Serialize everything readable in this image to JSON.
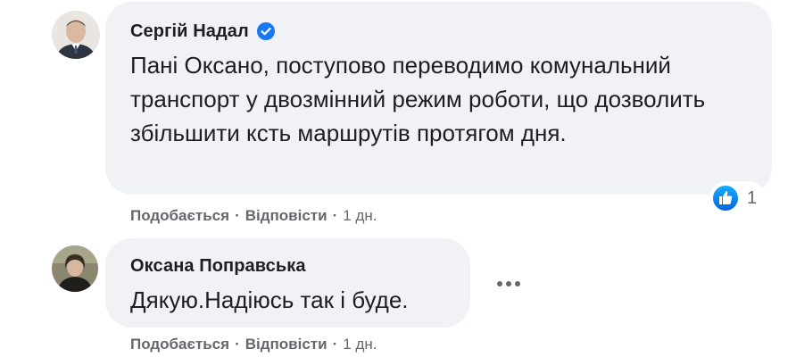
{
  "comments": [
    {
      "author": "Сергій Надал",
      "verified": true,
      "text": "Пані Оксано, поступово переводимо комунальний транспорт у двозмінний режим роботи, що дозволить збільшити ксть маршрутів протягом дня.",
      "reactions": {
        "icon": "like-icon",
        "count": "1"
      },
      "actions": {
        "like": "Подобається",
        "reply": "Відповісти",
        "time": "1 дн."
      }
    },
    {
      "author": "Оксана Поправська",
      "verified": false,
      "text": "Дякую.Надіюсь так і буде.",
      "actions": {
        "like": "Подобається",
        "reply": "Відповісти",
        "time": "1 дн."
      }
    }
  ],
  "separator": "·",
  "colors": {
    "bubble": "#f0f2f5",
    "text": "#1c1e21",
    "secondary_text": "#65676b",
    "accent": "#1877f2"
  }
}
